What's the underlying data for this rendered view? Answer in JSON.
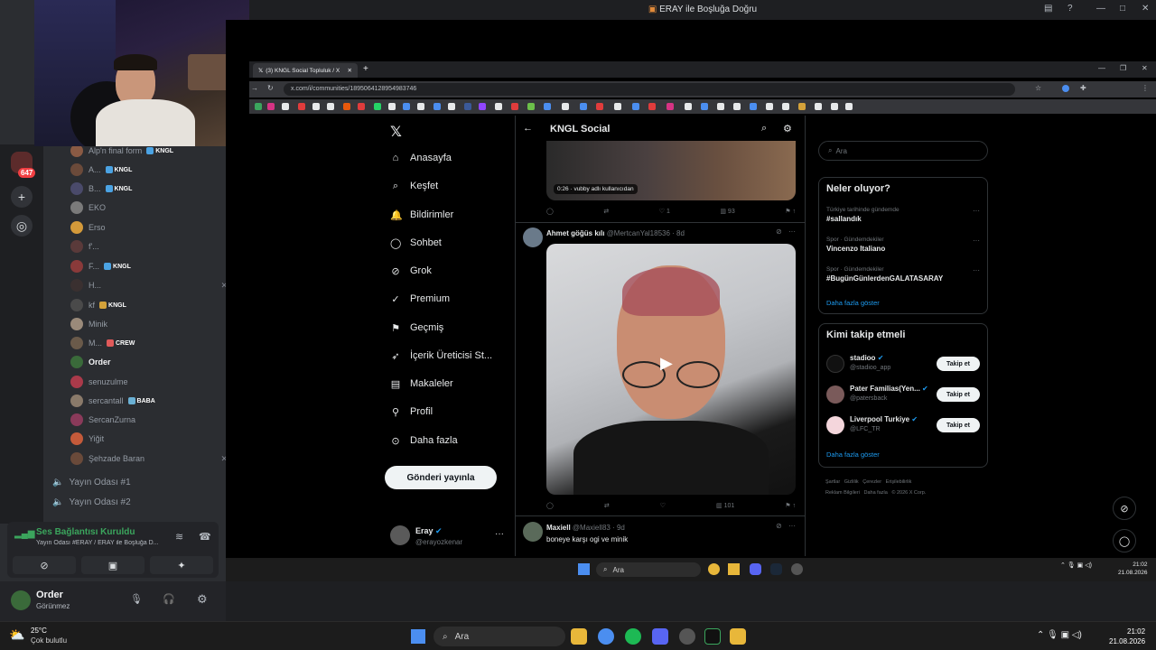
{
  "window": {
    "title": "ERAY ile Boşluğa Doğru"
  },
  "discord": {
    "server_badge": "647",
    "members": [
      {
        "name": "Alp'n final form",
        "tag": "KNGL"
      },
      {
        "name": "A...",
        "tag": "KNGL"
      },
      {
        "name": "B...",
        "tag": "KNGL"
      },
      {
        "name": "EKO",
        "tag": ""
      },
      {
        "name": "Erso",
        "tag": ""
      },
      {
        "name": "f'...",
        "tag": ""
      },
      {
        "name": "F...",
        "tag": "KNGL"
      },
      {
        "name": "H...",
        "tag": ""
      },
      {
        "name": "kf",
        "tag": "KNGL"
      },
      {
        "name": "Minik",
        "tag": ""
      },
      {
        "name": "M...",
        "tag": "CREW"
      },
      {
        "name": "Order",
        "tag": ""
      },
      {
        "name": "senuzulme",
        "tag": ""
      },
      {
        "name": "sercantall",
        "tag": "BABA"
      },
      {
        "name": "SercanZurna",
        "tag": ""
      },
      {
        "name": "Yiğit",
        "tag": ""
      },
      {
        "name": "Şehzade Baran",
        "tag": ""
      }
    ],
    "voice_channels": [
      "Yayın Odası #1",
      "Yayın Odası #2"
    ],
    "voice_status": {
      "title": "Ses Bağlantısı Kuruldu",
      "subtitle": "Yayın Odası #ERAY / ERAY ile Boşluğa D..."
    },
    "user": {
      "name": "Order",
      "status": "Görünmez"
    }
  },
  "browser": {
    "tab_title": "(3) KNGL Social Topluluk / X",
    "url": "x.com/i/communities/1895064128954983746"
  },
  "x": {
    "nav": [
      "Anasayfa",
      "Keşfet",
      "Bildirimler",
      "Sohbet",
      "Grok",
      "Premium",
      "Geçmiş",
      "İçerik Üreticisi St...",
      "Makaleler",
      "Profil",
      "Daha fazla"
    ],
    "post_button": "Gönderi yayınla",
    "account": {
      "name": "Eray",
      "handle": "@erayozkenar"
    },
    "header_title": "KNGL Social",
    "feed": {
      "video_time": "0:26",
      "video_credit": "vubby adlı kullanıcıdan",
      "post1_actions": {
        "replies": "",
        "reposts": "",
        "likes": "1",
        "views": "93"
      },
      "post2": {
        "author": "Ahmet göğüs kılı",
        "handle": "@MertcanYal18536 · 8d",
        "views": "101"
      },
      "post3": {
        "author": "Maxiell",
        "handle": "@Maxiell83 · 9d",
        "text": "boneye karşı ogi ve minik"
      }
    },
    "search_placeholder": "Ara",
    "trends": {
      "title": "Neler oluyor?",
      "items": [
        {
          "context": "Türkiye tarihinde gündemde",
          "name": "#sallandık"
        },
        {
          "context": "Spor · Gündemdekiler",
          "name": "Vincenzo Italiano"
        },
        {
          "context": "Spor · Gündemdekiler",
          "name": "#BugünGünlerdenGALATASARAY"
        }
      ],
      "more": "Daha fazla göster"
    },
    "who_to_follow": {
      "title": "Kimi takip etmeli",
      "items": [
        {
          "name": "stadioo",
          "handle": "@stadioo_app",
          "button": "Takip et"
        },
        {
          "name": "Pater Familias(Yen...",
          "handle": "@patersback",
          "button": "Takip et"
        },
        {
          "name": "Liverpool Turkiye",
          "handle": "@LFC_TR",
          "button": "Takip et"
        }
      ],
      "more": "Daha fazla göster"
    },
    "footer": [
      "Şartlar",
      "Gizlilik",
      "Çerezler",
      "Erişilebilirlik",
      "Reklam Bilgileri",
      "Daha fazla",
      "© 2026 X Corp."
    ]
  },
  "inner_taskbar": {
    "search": "Ara",
    "time": "21:02",
    "date": "21.08.2026"
  },
  "taskbar": {
    "weather_temp": "25°C",
    "weather_desc": "Çok bulutlu",
    "search": "Ara",
    "time": "21:02",
    "date": "21.08.2026"
  }
}
